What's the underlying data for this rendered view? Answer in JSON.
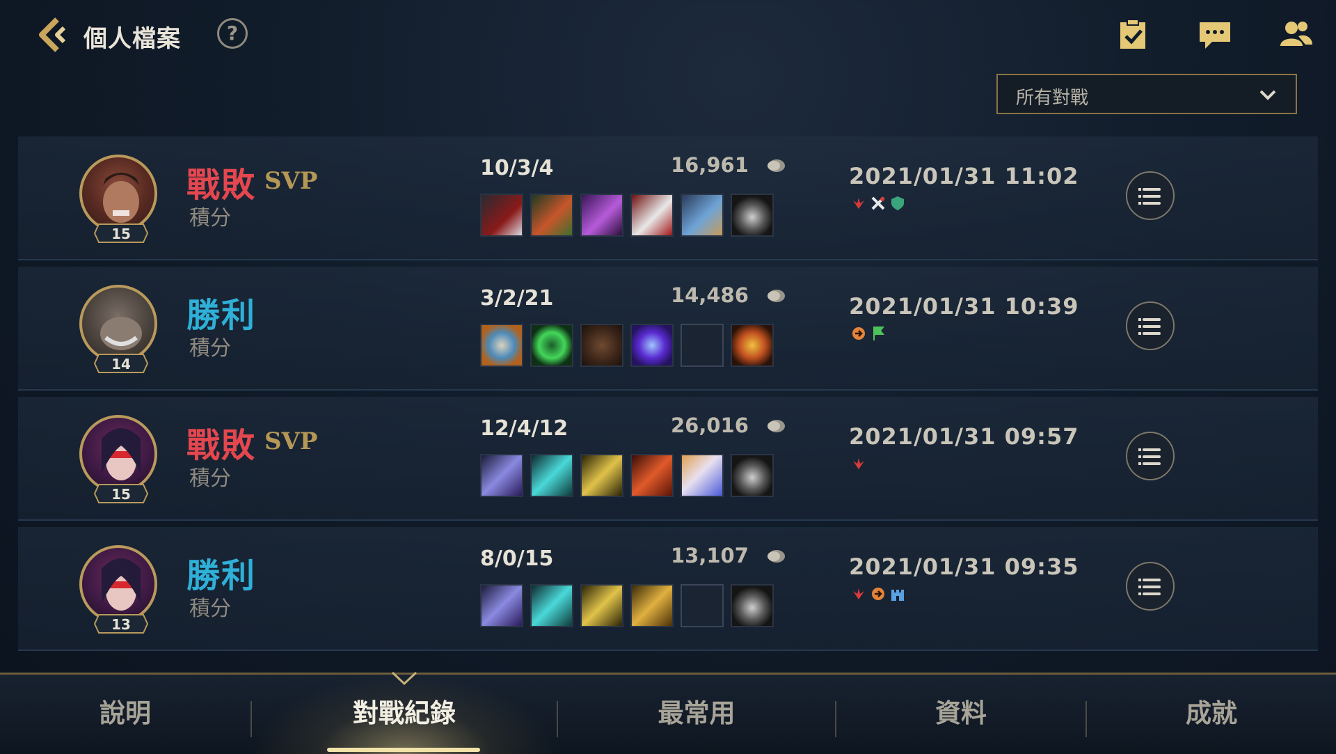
{
  "header": {
    "title": "個人檔案",
    "help_label": "?"
  },
  "filter": {
    "selected": "所有對戰"
  },
  "matches": [
    {
      "result": "戰敗",
      "svp": "SVP",
      "mode": "積分",
      "level": "15",
      "kda": "10/3/4",
      "gold": "16,961",
      "datetime": "2021/01/31 11:02",
      "badges": [
        "red-flower-icon",
        "crossed-swords-icon",
        "shield-icon"
      ]
    },
    {
      "result": "勝利",
      "svp": "",
      "mode": "積分",
      "level": "14",
      "kda": "3/2/21",
      "gold": "14,486",
      "datetime": "2021/01/31 10:39",
      "badges": [
        "hand-icon",
        "flag-icon"
      ]
    },
    {
      "result": "戰敗",
      "svp": "SVP",
      "mode": "積分",
      "level": "15",
      "kda": "12/4/12",
      "gold": "26,016",
      "datetime": "2021/01/31 09:57",
      "badges": [
        "red-flower-icon"
      ]
    },
    {
      "result": "勝利",
      "svp": "",
      "mode": "積分",
      "level": "13",
      "kda": "8/0/15",
      "gold": "13,107",
      "datetime": "2021/01/31 09:35",
      "badges": [
        "red-flower-icon",
        "hand-icon",
        "tower-icon"
      ]
    }
  ],
  "tabs": [
    "說明",
    "對戰紀錄",
    "最常用",
    "資料",
    "成就"
  ],
  "active_tab": "對戰紀錄",
  "colors": {
    "lose": "#e5474f",
    "win": "#2fb0d8",
    "svp": "#b59855",
    "accent_gold": "#b99a5c"
  }
}
